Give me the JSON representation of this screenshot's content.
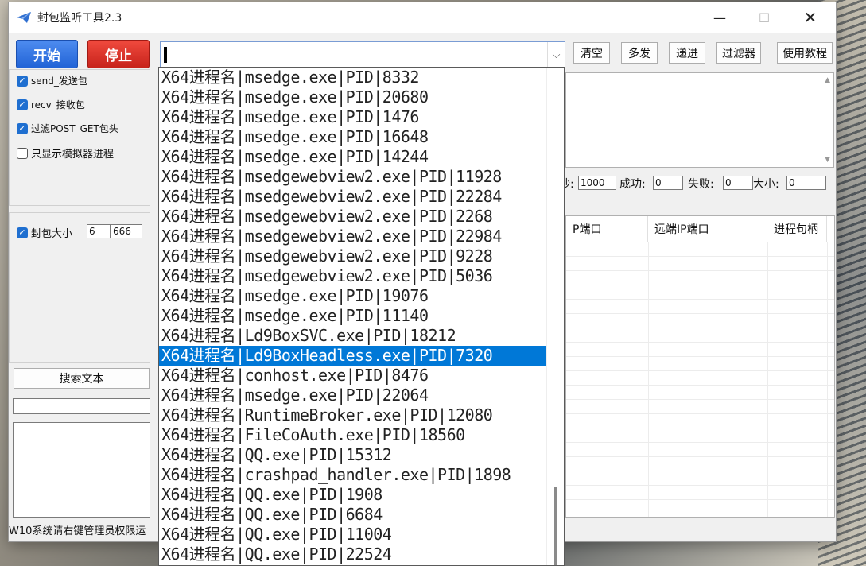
{
  "window": {
    "title": "封包监听工具2.3"
  },
  "toolbar": {
    "start_label": "开始",
    "stop_label": "停止",
    "clear_label": "清空",
    "multi_send_label": "多发",
    "forward_label": "递进",
    "filter_label": "过滤器",
    "tutorial_label": "使用教程"
  },
  "options": {
    "send_label": "send_发送包",
    "send_checked": true,
    "recv_label": "recv_接收包",
    "recv_checked": true,
    "filter_label": "过滤POST_GET包头",
    "filter_checked": true,
    "emulator_label": "只显示模拟器进程",
    "emulator_checked": false,
    "packet_size_label": "封包大小",
    "packet_size_checked": true,
    "packet_size_min": "6",
    "packet_size_max": "666"
  },
  "search": {
    "button_label": "搜索文本",
    "input_value": "",
    "results_text": ""
  },
  "status": {
    "text": "W10系统请右键管理员权限运"
  },
  "counters": {
    "per_second_label": "秒:",
    "per_second_value": "1000",
    "success_label": "成功:",
    "success_value": "0",
    "fail_label": "失败:",
    "fail_value": "0",
    "size_label": "大小:",
    "size_value": "0"
  },
  "table": {
    "headers": [
      "P端口",
      "远端IP端口",
      "进程句柄"
    ]
  },
  "process_combo": {
    "value": "",
    "selected_index": 14,
    "items": [
      "X64进程名|msedge.exe|PID|8332",
      "X64进程名|msedge.exe|PID|20680",
      "X64进程名|msedge.exe|PID|1476",
      "X64进程名|msedge.exe|PID|16648",
      "X64进程名|msedge.exe|PID|14244",
      "X64进程名|msedgewebview2.exe|PID|11928",
      "X64进程名|msedgewebview2.exe|PID|22284",
      "X64进程名|msedgewebview2.exe|PID|2268",
      "X64进程名|msedgewebview2.exe|PID|22984",
      "X64进程名|msedgewebview2.exe|PID|9228",
      "X64进程名|msedgewebview2.exe|PID|5036",
      "X64进程名|msedge.exe|PID|19076",
      "X64进程名|msedge.exe|PID|11140",
      "X64进程名|Ld9BoxSVC.exe|PID|18212",
      "X64进程名|Ld9BoxHeadless.exe|PID|7320",
      "X64进程名|conhost.exe|PID|8476",
      "X64进程名|msedge.exe|PID|22064",
      "X64进程名|RuntimeBroker.exe|PID|12080",
      "X64进程名|FileCoAuth.exe|PID|18560",
      "X64进程名|QQ.exe|PID|15312",
      "X64进程名|crashpad_handler.exe|PID|1898",
      "X64进程名|QQ.exe|PID|1908",
      "X64进程名|QQ.exe|PID|6684",
      "X64进程名|QQ.exe|PID|11004",
      "X64进程名|QQ.exe|PID|22524"
    ]
  }
}
